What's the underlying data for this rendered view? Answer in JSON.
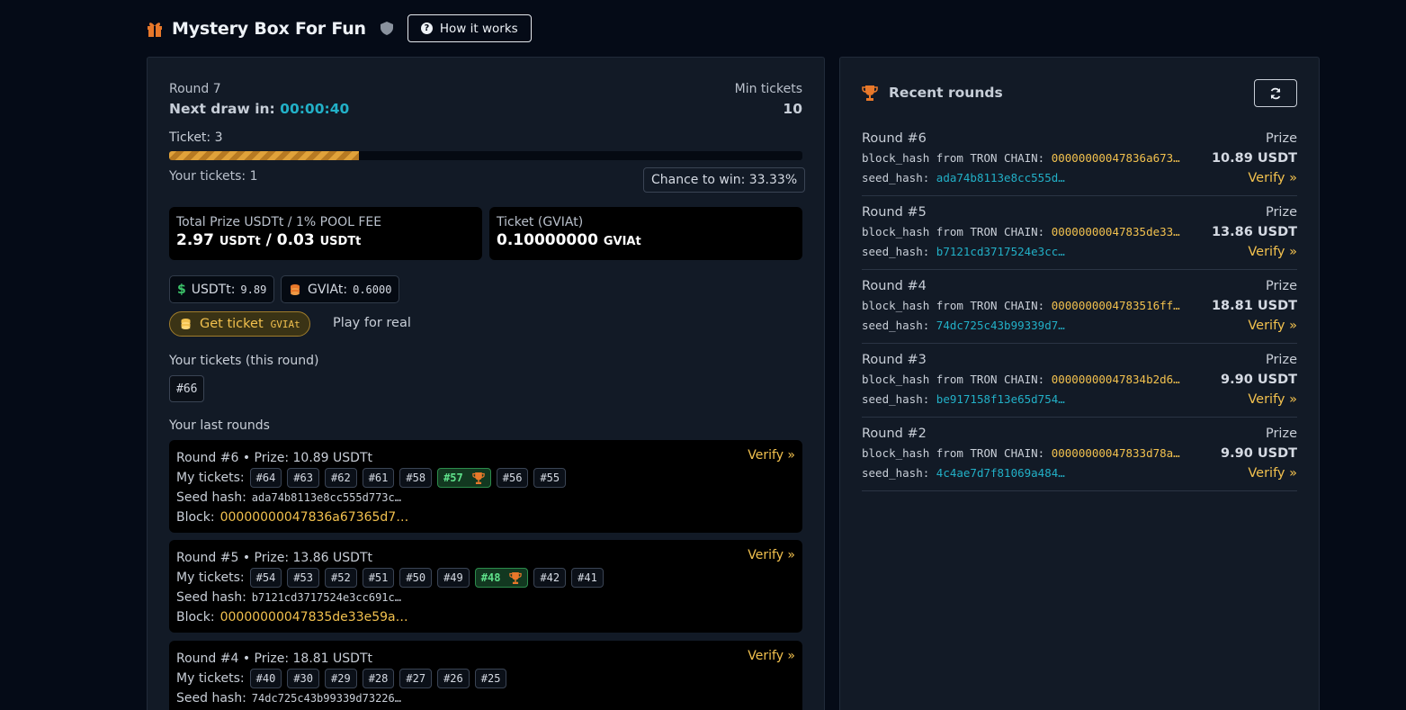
{
  "header": {
    "title": "Mystery Box For Fun",
    "how_it_works": "How it works",
    "qmark": "?"
  },
  "current_round": {
    "round_label": "Round 7",
    "next_draw_label": "Next draw in:",
    "countdown": "00:00:40",
    "min_tickets_label": "Min tickets",
    "min_tickets_value": "10",
    "ticket_label": "Ticket: 3",
    "progress_fraction": 0.3,
    "your_tickets": "Your tickets: 1",
    "chance": "Chance to win: 33.33%"
  },
  "stats": {
    "prize_label": "Total Prize USDTt / 1% POOL FEE",
    "prize_value": "2.97",
    "prize_unit": "USDTt",
    "separator": "/",
    "fee_value": "0.03",
    "fee_unit": "USDTt",
    "ticket_label": "Ticket (GVIAt)",
    "ticket_value": "0.10000000",
    "ticket_unit": "GVIAt"
  },
  "balances": {
    "usdt_symbol": "$",
    "usdt_label": "USDTt:",
    "usdt_value": "9.89",
    "gvia_label": "GVIAt:",
    "gvia_value": "0.6000"
  },
  "actions": {
    "get_ticket": "Get ticket",
    "get_ticket_token": "GVIAt",
    "play_for_real": "Play for real"
  },
  "my_tickets": {
    "heading": "Your tickets (this round)",
    "tickets": [
      "#66"
    ]
  },
  "last_rounds": {
    "heading": "Your last rounds",
    "my_tickets_label": "My tickets:",
    "seed_label": "Seed hash:",
    "block_label": "Block:",
    "verify": "Verify »",
    "items": [
      {
        "title": "Round #6 • Prize: 10.89 USDTt",
        "tickets": [
          "#64",
          "#63",
          "#62",
          "#61",
          "#58",
          "#57",
          "#56",
          "#55"
        ],
        "winner": "#57",
        "seed": "ada74b8113e8cc555d773c…",
        "block": "00000000047836a67365d7…"
      },
      {
        "title": "Round #5 • Prize: 13.86 USDTt",
        "tickets": [
          "#54",
          "#53",
          "#52",
          "#51",
          "#50",
          "#49",
          "#48",
          "#42",
          "#41"
        ],
        "winner": "#48",
        "seed": "b7121cd3717524e3cc691c…",
        "block": "00000000047835de33e59a…"
      },
      {
        "title": "Round #4 • Prize: 18.81 USDTt",
        "tickets": [
          "#40",
          "#30",
          "#29",
          "#28",
          "#27",
          "#26",
          "#25"
        ],
        "winner": "",
        "seed": "74dc725c43b99339d73226…",
        "block": ""
      }
    ]
  },
  "recent": {
    "heading": "Recent rounds",
    "prize_label": "Prize",
    "block_prefix": "block_hash from TRON CHAIN:",
    "seed_prefix": "seed_hash:",
    "verify": "Verify »",
    "items": [
      {
        "round": "Round #6",
        "block": "00000000047836a673…",
        "seed": "ada74b8113e8cc555d…",
        "prize": "10.89 USDT"
      },
      {
        "round": "Round #5",
        "block": "00000000047835de33…",
        "seed": "b7121cd3717524e3cc…",
        "prize": "13.86 USDT"
      },
      {
        "round": "Round #4",
        "block": "0000000004783516ff…",
        "seed": "74dc725c43b99339d7…",
        "prize": "18.81 USDT"
      },
      {
        "round": "Round #3",
        "block": "00000000047834b2d6…",
        "seed": "be917158f13e65d754…",
        "prize": "9.90 USDT"
      },
      {
        "round": "Round #2",
        "block": "00000000047833d78a…",
        "seed": "4c4ae7d7f81069a484…",
        "prize": "9.90 USDT"
      }
    ]
  },
  "colors": {
    "accent_gold": "#f2c14e",
    "countdown_teal": "#22b0c7",
    "winner_green": "#5fe08a",
    "trophy_orange": "#e8782a"
  },
  "icons": [
    "gift-icon",
    "shield-icon",
    "question-icon",
    "trophy-icon",
    "refresh-icon",
    "dollar-icon",
    "coins-icon"
  ]
}
